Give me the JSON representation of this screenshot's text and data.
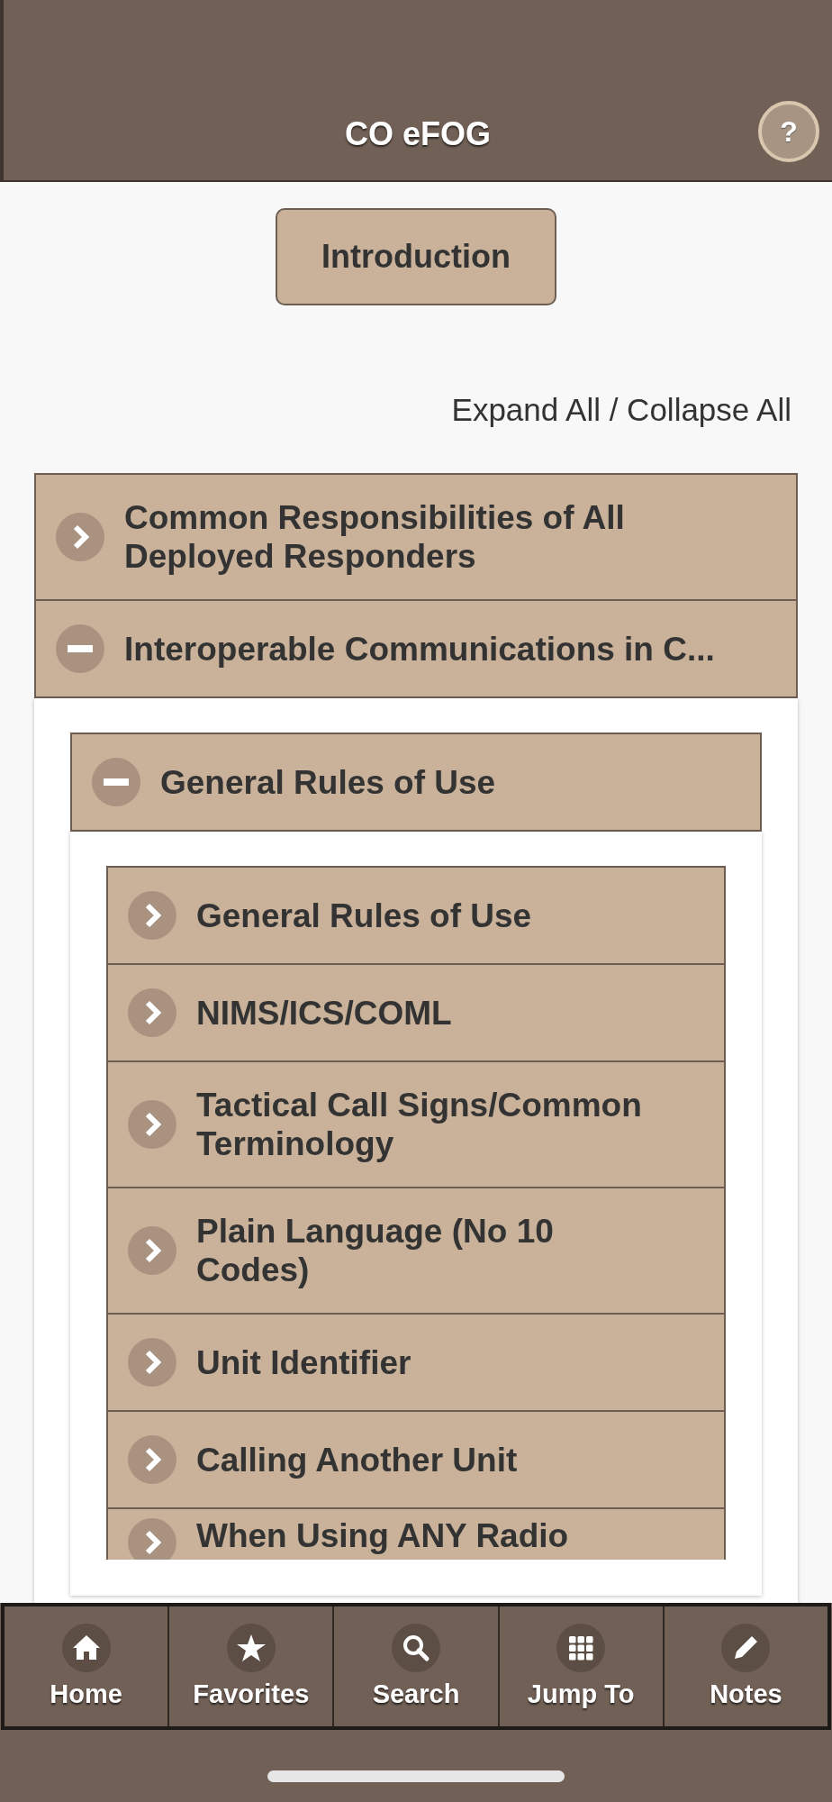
{
  "header": {
    "title": "CO eFOG",
    "help_label": "?"
  },
  "intro_button": "Introduction",
  "expand_collapse": "Expand All / Collapse All",
  "sections": [
    {
      "title": "Common Responsibilities of All Deployed Responders",
      "expanded": false
    },
    {
      "title": "Interoperable Communications in C...",
      "expanded": true,
      "children": [
        {
          "title": "General Rules of Use",
          "expanded": true,
          "children": [
            {
              "title": "General Rules of Use",
              "expanded": false
            },
            {
              "title": "NIMS/ICS/COML",
              "expanded": false
            },
            {
              "title": "Tactical Call Signs/Common Terminology",
              "expanded": false
            },
            {
              "title": "Plain Language (No 10 Codes)",
              "expanded": false
            },
            {
              "title": "Unit Identifier",
              "expanded": false
            },
            {
              "title": "Calling Another Unit",
              "expanded": false
            },
            {
              "title": "When Using ANY Radio",
              "expanded": false,
              "cut_off": true
            }
          ]
        }
      ]
    }
  ],
  "nav": [
    {
      "label": "Home",
      "kind": "home"
    },
    {
      "label": "Favorites",
      "kind": "star"
    },
    {
      "label": "Search",
      "kind": "search"
    },
    {
      "label": "Jump To",
      "kind": "grid"
    },
    {
      "label": "Notes",
      "kind": "pencil"
    }
  ]
}
